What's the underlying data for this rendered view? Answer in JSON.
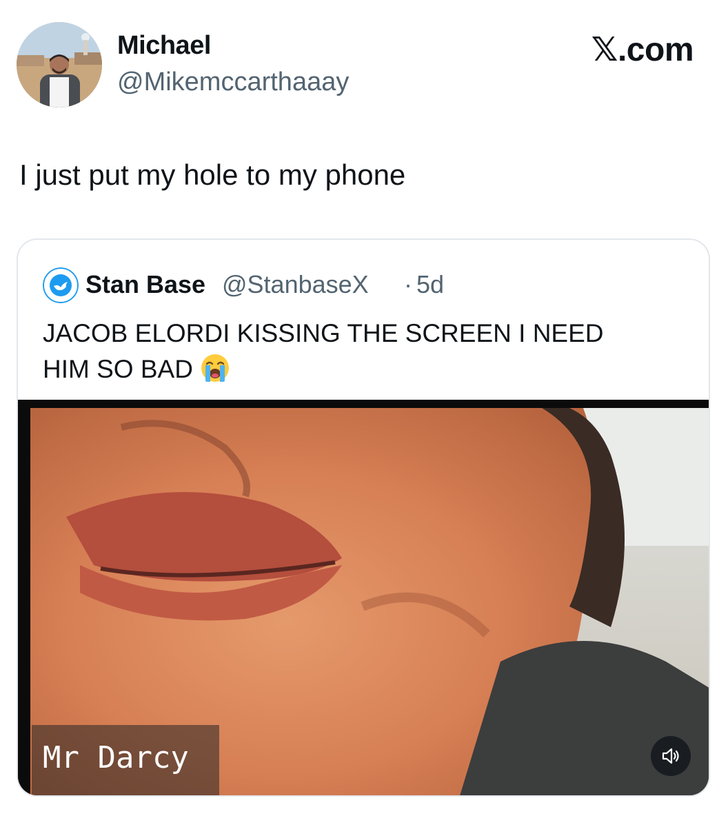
{
  "author": {
    "name": "Michael",
    "handle": "@Mikemccarthaaay",
    "avatar": "profile-photo"
  },
  "site_mark": {
    "glyph": "𝕏",
    "suffix": ".com"
  },
  "tweet": {
    "text": "I just put my hole to my phone"
  },
  "quoted": {
    "name": "Stan Base",
    "handle": "@StanbaseX",
    "separator": "·",
    "time": "5d",
    "text_line1": "JACOB ELORDI KISSING THE SCREEN I NEED",
    "text_line2": "HIM SO BAD",
    "emoji": "loudly-crying-face-emoji",
    "media": {
      "type": "video",
      "caption": "Mr Darcy",
      "control_icon": "speaker-muted-icon"
    }
  },
  "colors": {
    "text_primary": "#0f1419",
    "text_secondary": "#536471",
    "card_border": "#e3e7eb",
    "brand_blue": "#1d9bf0"
  }
}
